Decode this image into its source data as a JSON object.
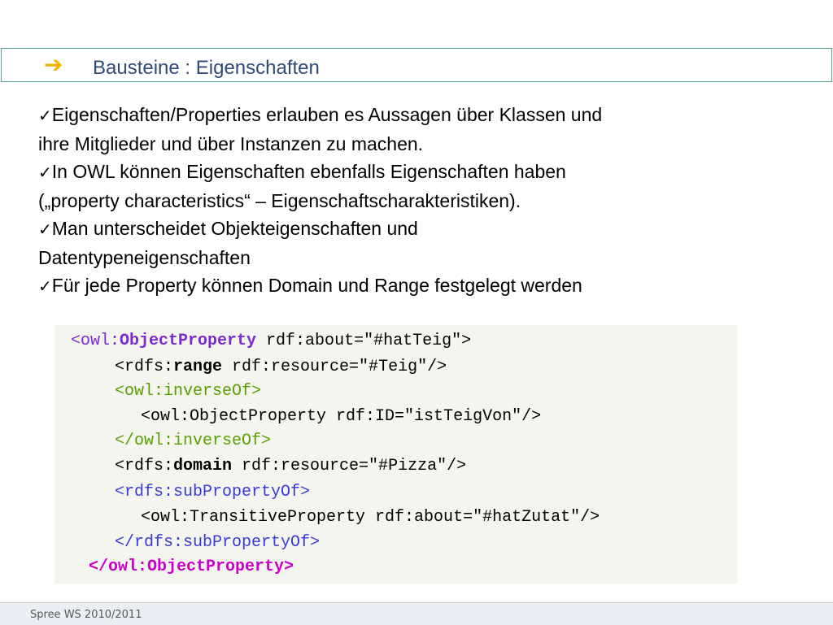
{
  "slide": {
    "title": "Bausteine : Eigenschaften",
    "title_icon": "right-arrow-icon",
    "accent_color": "#f0b400",
    "title_color": "#2e4a78"
  },
  "bullets": {
    "check_glyph": "✓",
    "items": [
      {
        "line1": "Eigenschaften/Properties erlauben es Aussagen über Klassen und",
        "line2": "ihre Mitglieder und über Instanzen zu machen."
      },
      {
        "line1": "In OWL können Eigenschaften ebenfalls Eigenschaften haben",
        "line2": "(„property characteristics“ – Eigenschaftscharakteristiken)."
      },
      {
        "line1": "Man unterscheidet Objekteigenschaften und",
        "line2": "Datentypeneigenschaften"
      },
      {
        "line1": "Für jede Property können Domain und Range festgelegt werden",
        "line2": ""
      }
    ]
  },
  "code": {
    "l1_prefix": "<owl:",
    "l1_keyword": "ObjectProperty",
    "l1_rest": " rdf:about=\"#hatTeig\">",
    "l2_prefix": "<rdfs:",
    "l2_keyword": "range",
    "l2_rest": " rdf:resource=\"#Teig\"/>",
    "l3": "<owl:inverseOf>",
    "l4": "<owl:ObjectProperty rdf:ID=\"istTeigVon\"/>",
    "l5": "</owl:inverseOf>",
    "l6_prefix": "<rdfs:",
    "l6_keyword": "domain",
    "l6_rest": " rdf:resource=\"#Pizza\"/>",
    "l7": "<rdfs:subPropertyOf>",
    "l8": "<owl:TransitiveProperty rdf:about=\"#hatZutat\"/>",
    "l9": "</rdfs:subPropertyOf>",
    "l10": "</owl:ObjectProperty>"
  },
  "footer": {
    "text": "Spree WS 2010/2011"
  }
}
